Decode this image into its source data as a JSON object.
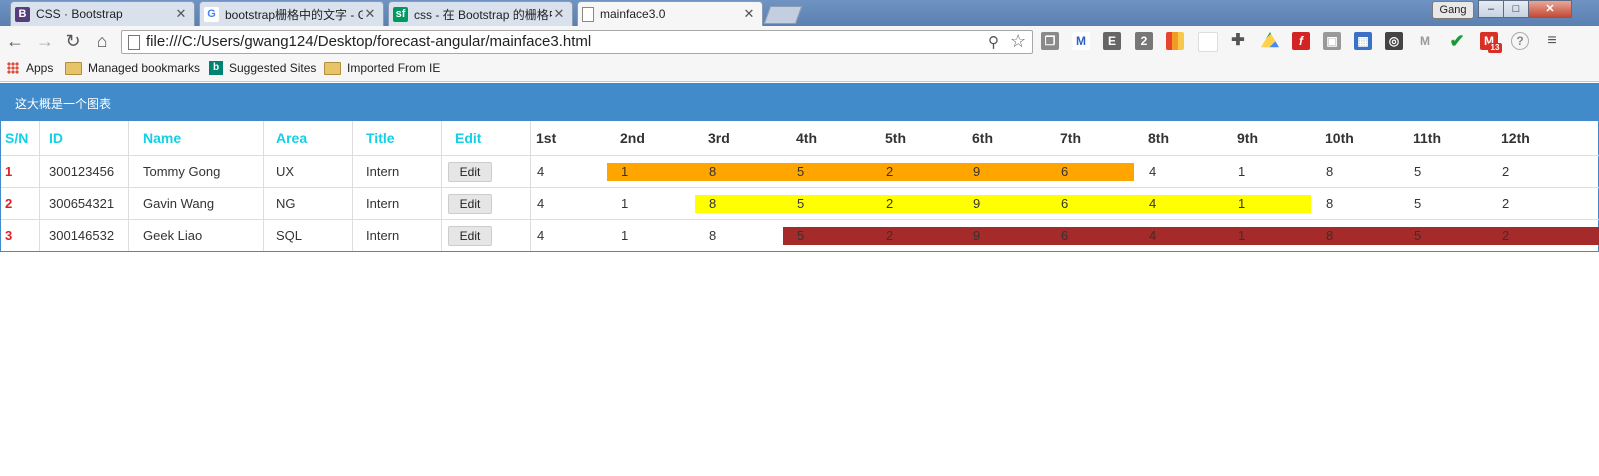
{
  "browser": {
    "tabs": [
      {
        "title": "CSS · Bootstrap",
        "favicon": "B",
        "favicon_color": "#563d7c",
        "active": false
      },
      {
        "title": "bootstrap栅格中的文字 - G",
        "favicon": "G",
        "favicon_color": "#4285f4",
        "active": false
      },
      {
        "title": "css - 在 Bootstrap 的栅格中",
        "favicon": "sf",
        "favicon_color": "#009a61",
        "active": false
      },
      {
        "title": "mainface3.0",
        "favicon": "",
        "favicon_color": "#ffffff",
        "active": true
      }
    ],
    "profile_name": "Gang",
    "address": "file:///C:/Users/gwang124/Desktop/forecast-angular/mainface3.html",
    "extension_icons": [
      "copy-icon",
      "gmail-icon",
      "e-icon",
      "two-icon",
      "chart-ext-icon",
      "blank-ext-icon",
      "puzzle-icon",
      "drive-icon",
      "flash-icon",
      "photo-icon",
      "calendar-icon",
      "screen-icon",
      "mail-icon",
      "check-icon",
      "gmail-badge-icon",
      "help-icon"
    ],
    "gmail_badge": "13",
    "bookmarks": [
      "Apps",
      "Managed bookmarks",
      "Suggested Sites",
      "Imported From IE"
    ]
  },
  "page": {
    "panel_title": "这大概是一个图表",
    "columns": [
      "S/N",
      "ID",
      "Name",
      "Area",
      "Title",
      "Edit",
      "1st",
      "2nd",
      "3rd",
      "4th",
      "5th",
      "6th",
      "7th",
      "8th",
      "9th",
      "10th",
      "11th",
      "12th"
    ],
    "edit_label": "Edit",
    "rows": [
      {
        "sn": "1",
        "id": "300123456",
        "name": "Tommy Gong",
        "area": "UX",
        "title": "Intern",
        "values": [
          "4",
          "1",
          "8",
          "5",
          "2",
          "9",
          "6",
          "4",
          "1",
          "8",
          "5",
          "2"
        ],
        "bar_start": 2,
        "bar_end": 7,
        "bar_color": "#ffa500"
      },
      {
        "sn": "2",
        "id": "300654321",
        "name": "Gavin Wang",
        "area": "NG",
        "title": "Intern",
        "values": [
          "4",
          "1",
          "8",
          "5",
          "2",
          "9",
          "6",
          "4",
          "1",
          "8",
          "5",
          "2"
        ],
        "bar_start": 3,
        "bar_end": 9,
        "bar_color": "#ffff00"
      },
      {
        "sn": "3",
        "id": "300146532",
        "name": "Geek Liao",
        "area": "SQL",
        "title": "Intern",
        "values": [
          "4",
          "1",
          "8",
          "5",
          "2",
          "9",
          "6",
          "4",
          "1",
          "8",
          "5",
          "2"
        ],
        "bar_start": 4,
        "bar_end": 12,
        "bar_color": "#a52a2a"
      }
    ]
  }
}
